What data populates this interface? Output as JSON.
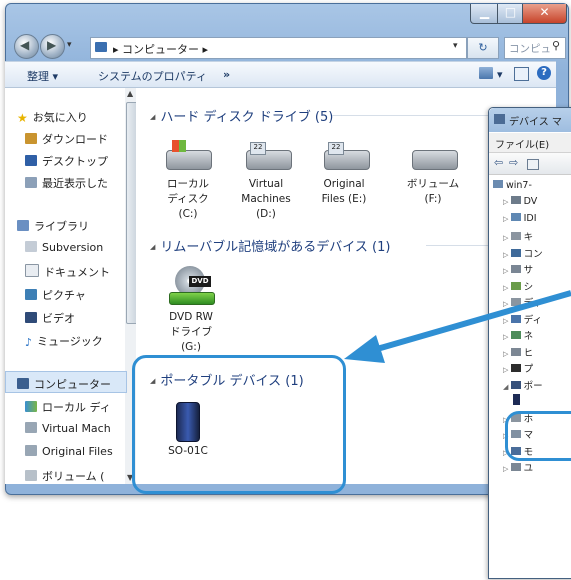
{
  "explorer": {
    "breadcrumb": "▸ コンピューター ▸",
    "search_placeholder": "コンピュー...",
    "toolbar": {
      "organize": "整理 ▾",
      "system_properties": "システムのプロパティ",
      "more": "»"
    },
    "nav": {
      "favorites": "お気に入り",
      "downloads": "ダウンロード",
      "desktop": "デスクトップ",
      "recent": "最近表示した",
      "libraries": "ライブラリ",
      "subversion": "Subversion",
      "documents": "ドキュメント",
      "pictures": "ピクチャ",
      "videos": "ビデオ",
      "music": "ミュージック",
      "computer": "コンピューター",
      "local_disk": "ローカル ディ",
      "virtual_machines": "Virtual Mach",
      "original_files": "Original Files",
      "volume": "ボリューム ("
    },
    "groups": {
      "hdd": "ハード ディスク ドライブ (5)",
      "removable": "リムーバブル記憶域があるデバイス (1)",
      "portable": "ポータブル デバイス (1)"
    },
    "drives": [
      {
        "line1": "ローカル",
        "line2": "ディスク",
        "line3": "(C:)"
      },
      {
        "line1": "Virtual",
        "line2": "Machines",
        "line3": "(D:)"
      },
      {
        "line1": "Original",
        "line2": "Files (E:)",
        "line3": ""
      },
      {
        "line1": "ボリューム",
        "line2": "(F:)",
        "line3": ""
      }
    ],
    "dvd": {
      "line1": "DVD RW",
      "line2": "ドライブ",
      "line3": "(G:)",
      "badge": "DVD"
    },
    "portable_device": "SO-01C"
  },
  "devmgr": {
    "title": "デバイス マ",
    "menu_file": "ファイル(E)",
    "root": "win7-",
    "rows": [
      "DV",
      "IDI",
      "キ",
      "コン",
      "サ",
      "シ",
      "ディ",
      "ディ",
      "ネ",
      "ヒ",
      "プ",
      "ポー",
      "",
      "ホ",
      "マ",
      "モ",
      "ユ"
    ]
  },
  "colors": {
    "callout": "#2f8fd3",
    "group_header": "#1f3f7e",
    "close_button": "#c7432a"
  }
}
